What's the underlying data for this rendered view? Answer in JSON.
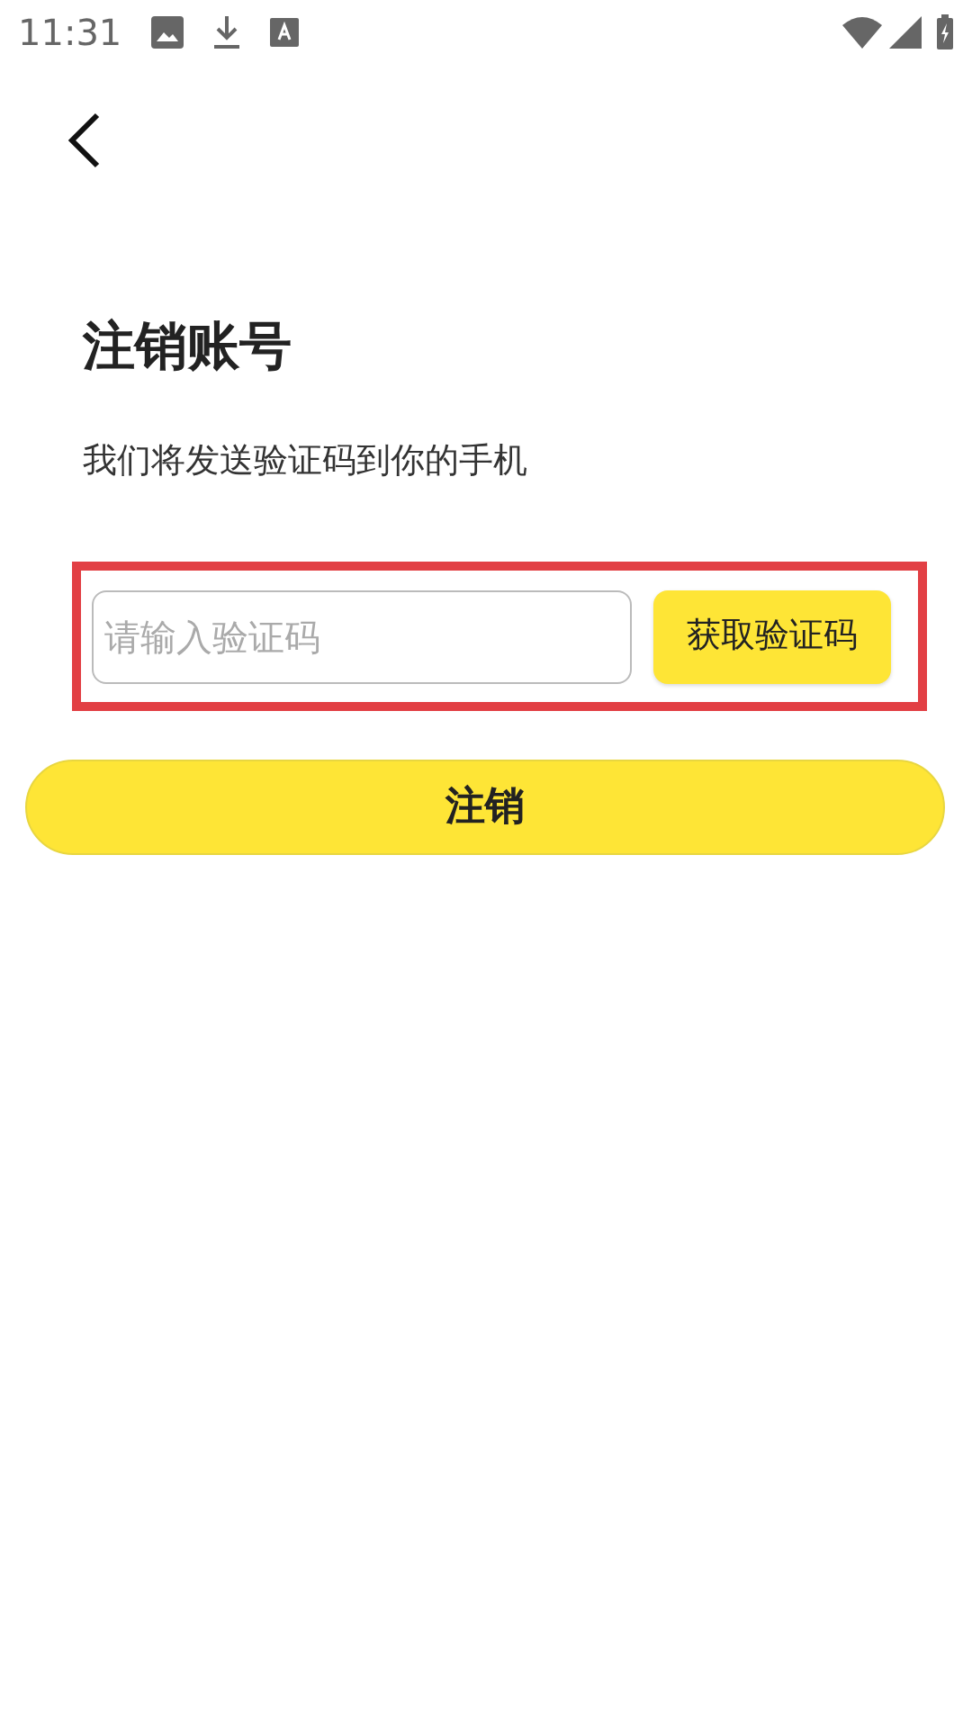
{
  "status_bar": {
    "time": "11:31"
  },
  "title": "注销账号",
  "subtitle": "我们将发送验证码到你的手机",
  "code_field": {
    "placeholder": "请输入验证码"
  },
  "get_code_button": "获取验证码",
  "highlight": true,
  "submit_button": "注销"
}
